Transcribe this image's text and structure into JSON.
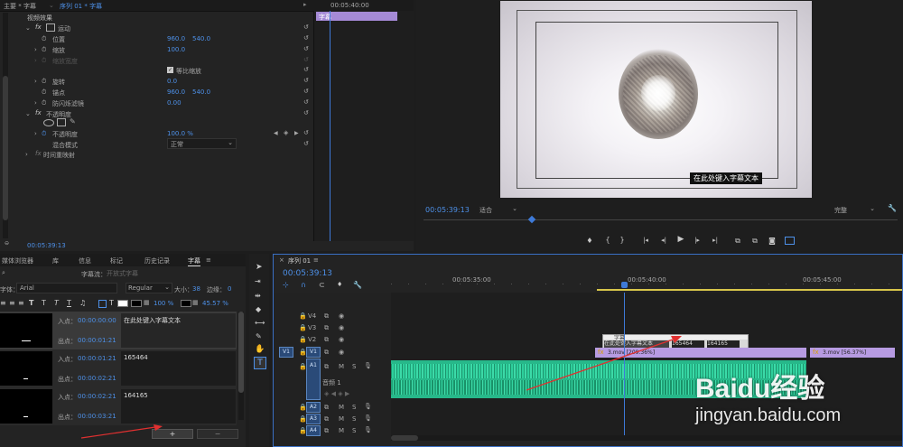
{
  "effect_controls": {
    "header_left": "主要 * 字幕",
    "header_seq": "序列 01 * 字幕",
    "section_video": "视频效果",
    "fx_motion": "运动",
    "prop_position": "位置",
    "pos_x": "960.0",
    "pos_y": "540.0",
    "prop_scale": "缩放",
    "scale_val": "100.0",
    "prop_scale_width": "缩放宽度",
    "uniform_scale": "等比缩放",
    "prop_rotation": "旋转",
    "rotation_val": "0.0",
    "prop_anchor": "锚点",
    "anchor_x": "960.0",
    "anchor_y": "540.0",
    "prop_antiflicker": "防闪烁滤镜",
    "antiflicker_val": "0.00",
    "fx_opacity": "不透明度",
    "prop_opacity": "不透明度",
    "opacity_val": "100.0 %",
    "prop_blend": "混合模式",
    "blend_val": "正常",
    "fx_timeremap": "时间重映射",
    "timecode": "00:05:39:13",
    "mini_timecode": "00:05:40:00",
    "mini_clip_label": "字幕"
  },
  "program_monitor": {
    "caption_text": "在此处键入字幕文本",
    "timecode": "00:05:39:13",
    "fit_label": "适合",
    "full_label": "完整"
  },
  "captions_panel": {
    "tabs": [
      "媒体浏览器",
      "库",
      "信息",
      "标记",
      "历史记录",
      "字幕"
    ],
    "active_tab": "字幕",
    "stream_label": "字幕流：",
    "stream_value": "开放式字幕",
    "font_label": "字体：",
    "font_value": "Arial",
    "style_value": "Regular",
    "size_label": "大小：",
    "size_value": "38",
    "edge_label": "边缘：",
    "edge_value": "0",
    "opacity_value": "100 %",
    "opacity2_value": "45.57 %",
    "in_label": "入点：",
    "out_label": "出点：",
    "items": [
      {
        "in": "00:00:00:00",
        "out": "00:00:01:21",
        "text": "在此处键入字幕文本"
      },
      {
        "in": "00:00:01:21",
        "out": "00:00:02:21",
        "text": "165464"
      },
      {
        "in": "00:00:02:21",
        "out": "00:00:03:21",
        "text": "164165"
      }
    ],
    "add_symbol": "+",
    "remove_symbol": "−"
  },
  "timeline": {
    "tab_label": "序列 01",
    "timecode": "00:05:39:13",
    "ruler_labels": [
      "00:05:35:00",
      "00:05:40:00",
      "00:05:45:00"
    ],
    "tracks_video": [
      "V4",
      "V3",
      "V2",
      "V1"
    ],
    "tracks_audio": [
      "A1",
      "A2",
      "A3",
      "A4"
    ],
    "source_v1": "V1",
    "source_a1": "A1",
    "audio_label": "音频 1",
    "caption_clip_label": "字幕",
    "caption_clip_text1": "在此处键入字幕文本",
    "caption_clip_text2": "165464",
    "caption_clip_text3": "164165",
    "clip1_label": "3.mov [209.36%]",
    "clip2_label": "3.mov [56.37%]",
    "track_m": "M",
    "track_s": "S"
  },
  "watermark": {
    "logo_text": "Baidu经验",
    "url": "jingyan.baidu.com"
  }
}
